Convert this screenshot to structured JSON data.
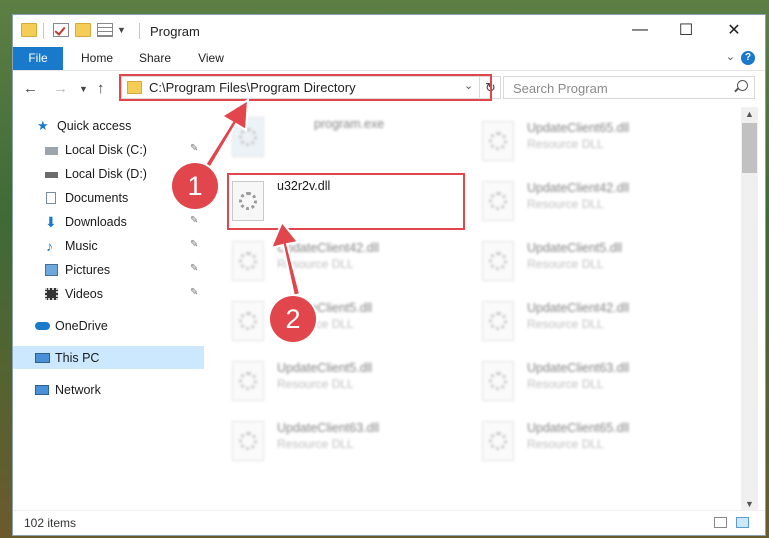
{
  "window": {
    "title": "Program"
  },
  "ribbon": {
    "tabs": [
      "File",
      "Home",
      "Share",
      "View"
    ],
    "help": "?"
  },
  "address": {
    "path": "C:\\Program Files\\Program Directory",
    "search_placeholder": "Search Program"
  },
  "sidebar": {
    "quick_access": "Quick access",
    "items": [
      {
        "label": "Local Disk (C:)",
        "icon": "drive-icon",
        "pinned": true
      },
      {
        "label": "Local Disk (D:)",
        "icon": "drive-icon",
        "pinned": false
      },
      {
        "label": "Documents",
        "icon": "documents-icon",
        "pinned": true
      },
      {
        "label": "Downloads",
        "icon": "downloads-icon",
        "pinned": true
      },
      {
        "label": "Music",
        "icon": "music-icon",
        "pinned": true
      },
      {
        "label": "Pictures",
        "icon": "pictures-icon",
        "pinned": true
      },
      {
        "label": "Videos",
        "icon": "videos-icon",
        "pinned": true
      }
    ],
    "onedrive": "OneDrive",
    "this_pc": "This PC",
    "network": "Network"
  },
  "files": {
    "left": [
      {
        "name": "program.exe",
        "type": ""
      },
      {
        "name": "u32r2v.dll",
        "type": ""
      },
      {
        "name": "UpdateClient42.dll",
        "type": "Resource DLL"
      },
      {
        "name": "UpdateClient5.dll",
        "type": "Resource DLL"
      },
      {
        "name": "UpdateClient5.dll",
        "type": "Resource DLL"
      },
      {
        "name": "UpdateClient63.dll",
        "type": "Resource DLL"
      }
    ],
    "right": [
      {
        "name": "UpdateClient65.dll",
        "type": "Resource DLL"
      },
      {
        "name": "UpdateClient42.dll",
        "type": "Resource DLL"
      },
      {
        "name": "UpdateClient5.dll",
        "type": "Resource DLL"
      },
      {
        "name": "UpdateClient42.dll",
        "type": "Resource DLL"
      },
      {
        "name": "UpdateClient63.dll",
        "type": "Resource DLL"
      },
      {
        "name": "UpdateClient65.dll",
        "type": "Resource DLL"
      }
    ]
  },
  "status": {
    "item_count": "102 items"
  },
  "callouts": [
    "1",
    "2"
  ],
  "colors": {
    "accent": "#1979ca",
    "highlight": "#e0464c",
    "selected": "#cce8ff"
  }
}
